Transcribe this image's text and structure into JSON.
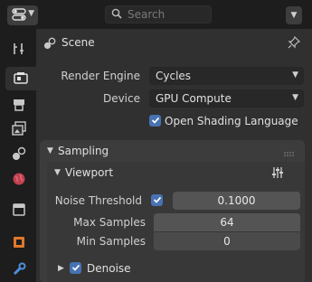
{
  "header": {
    "search_placeholder": "Search",
    "icons": [
      "editor-type-icon",
      "search-icon",
      "chevron-down-icon"
    ]
  },
  "tabs": [
    {
      "name": "tool-icon"
    },
    {
      "name": "render-icon",
      "active": true
    },
    {
      "name": "output-icon"
    },
    {
      "name": "view-layer-icon"
    },
    {
      "name": "scene-icon"
    },
    {
      "name": "world-icon"
    },
    {
      "name": "collection-icon"
    },
    {
      "name": "object-icon"
    },
    {
      "name": "modifier-icon"
    }
  ],
  "panel": {
    "context_title": "Scene",
    "render_engine": {
      "label": "Render Engine",
      "value": "Cycles"
    },
    "device": {
      "label": "Device",
      "value": "GPU Compute"
    },
    "osl": {
      "label": "Open Shading Language",
      "checked": true
    }
  },
  "sampling": {
    "title": "Sampling",
    "viewport": {
      "title": "Viewport",
      "noise_threshold": {
        "label": "Noise Threshold",
        "enabled": true,
        "value": "0.1000"
      },
      "max_samples": {
        "label": "Max Samples",
        "value": "64"
      },
      "min_samples": {
        "label": "Min Samples",
        "value": "0"
      },
      "denoise": {
        "label": "Denoise",
        "checked": true
      }
    }
  },
  "colors": {
    "accent": "#4772b3",
    "panel_bg": "#303030",
    "field_bg": "#545454"
  }
}
